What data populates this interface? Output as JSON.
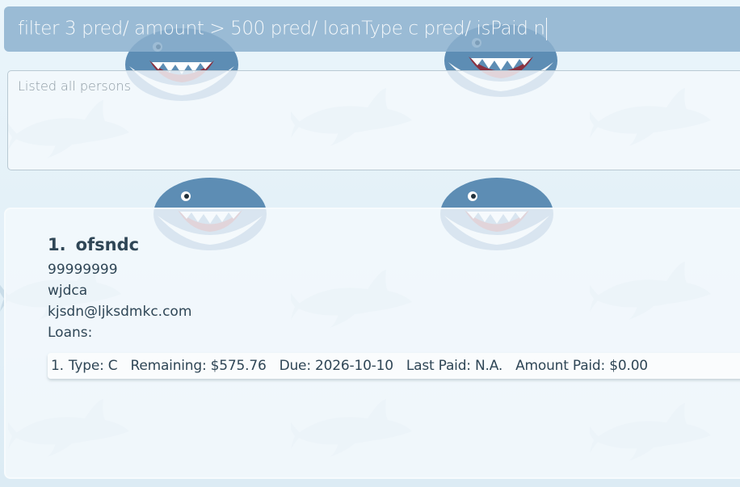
{
  "command_box": {
    "value": "filter 3 pred/ amount > 500 pred/ loanType c pred/ isPaid n"
  },
  "result_display": {
    "message": "Listed all persons"
  },
  "person_list": {
    "persons": [
      {
        "index": "1.",
        "name": "ofsndc",
        "phone": "99999999",
        "address": "wjdca",
        "email": "kjsdn@ljksdmkc.com",
        "loans_label": "Loans:",
        "loans": [
          {
            "index": "1.",
            "type": "Type: C",
            "remaining": "Remaining: $575.76",
            "due": "Due: 2026-10-10",
            "last_paid": "Last Paid: N.A.",
            "amount_paid": "Amount Paid: $0.00"
          }
        ]
      }
    ]
  },
  "theme": {
    "background": "#e4f0f7",
    "command_bar": "#8cb0ce",
    "text_dark": "#2f4656",
    "shark_body": "#4f7fa6",
    "icon": "shark-icon"
  }
}
